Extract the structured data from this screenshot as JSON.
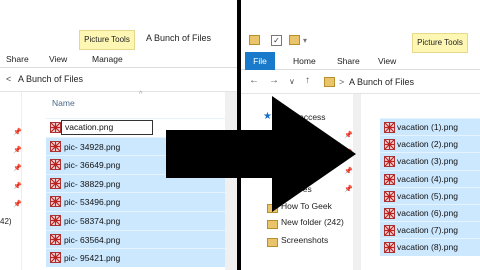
{
  "left": {
    "ribbon": {
      "picture_tools": "Picture Tools",
      "window_title": "A Bunch of Files",
      "tabs": [
        "Share",
        "View",
        "Manage"
      ]
    },
    "address": {
      "back_arrow": "<",
      "path": "A Bunch of Files"
    },
    "column_header": "Name",
    "side_text": "42)",
    "rename_value": "vacation.png",
    "files": [
      "pic- 34928.png",
      "pic- 36649.png",
      "pic- 38829.png",
      "pic- 53496.png",
      "pic- 58374.png",
      "pic- 63564.png",
      "pic- 95421.png"
    ]
  },
  "right": {
    "ribbon": {
      "picture_tools": "Picture Tools",
      "file_tab": "File",
      "tabs": [
        "Home",
        "Share",
        "View"
      ]
    },
    "address": {
      "back": "←",
      "forward": "→",
      "dropdown": "∨",
      "up": "↑",
      "separator": ">",
      "path": "A Bunch of Files"
    },
    "nav": {
      "quick_access": "Quick access",
      "items": [
        "ktop",
        "Pictures",
        "How To Geek",
        "New folder (242)",
        "Screenshots"
      ]
    },
    "files": [
      "vacation (1).png",
      "vacation (2).png",
      "vacation (3).png",
      "vacation (4).png",
      "vacation (5).png",
      "vacation (6).png",
      "vacation (7).png",
      "vacation (8).png"
    ]
  },
  "colors": {
    "selection": "#cce8ff",
    "file_tab": "#1979ca",
    "picture_tools": "#fef6b3",
    "background": "#000000"
  },
  "icons": [
    "image-file-icon",
    "folder-icon",
    "pin-icon",
    "star-icon",
    "arrow-right-icon"
  ]
}
